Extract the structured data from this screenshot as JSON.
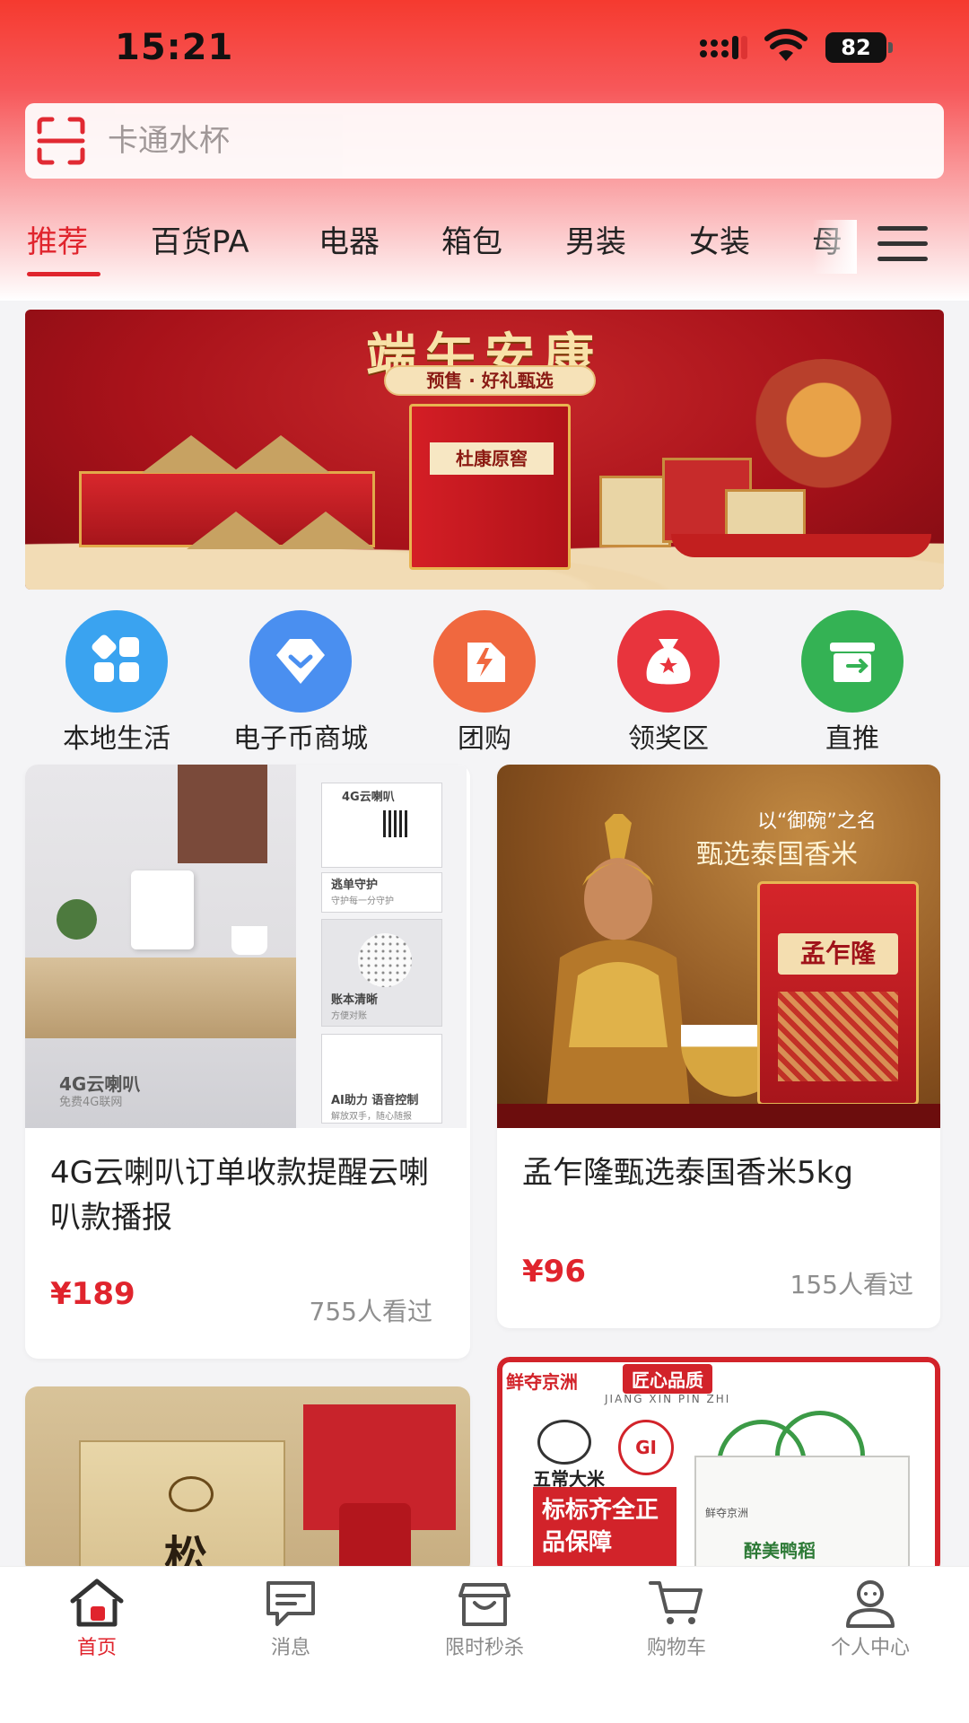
{
  "status_bar": {
    "time": "15:21",
    "battery": "82"
  },
  "search": {
    "placeholder": "卡通水杯"
  },
  "tabs": [
    {
      "label": "推荐",
      "active": true
    },
    {
      "label": "百货PA"
    },
    {
      "label": "电器"
    },
    {
      "label": "箱包"
    },
    {
      "label": "男装"
    },
    {
      "label": "女装"
    },
    {
      "label": "母"
    }
  ],
  "banner": {
    "title": "端午安康",
    "subtitle": "预售 · 好礼甄选",
    "box_label": "杜康原窖"
  },
  "quick_links": [
    {
      "label": "本地生活",
      "color": "#3aa3f0",
      "icon": "grid-icon"
    },
    {
      "label": "电子币商城",
      "color": "#4a8ff0",
      "icon": "diamond-chevron-icon"
    },
    {
      "label": "团购",
      "color": "#f0683f",
      "icon": "tag-lightning-icon"
    },
    {
      "label": "领奖区",
      "color": "#e8343d",
      "icon": "money-bag-icon"
    },
    {
      "label": "直推",
      "color": "#34b254",
      "icon": "share-box-icon"
    }
  ],
  "products": [
    {
      "title": "4G云喇叭订单收款提醒云喇叭款播报",
      "price": "¥189",
      "views": "755人看过",
      "image_text": {
        "caption": "4G云喇叭",
        "caption_sub": "免费4G联网",
        "panel1_title": "4G云喇叭",
        "panel2_title": "逃单守护",
        "panel2_sub": "守护每一分守护",
        "panel3_title": "账本清晰",
        "panel3_sub": "方便对账",
        "panel4_title": "AI助力 语音控制",
        "panel4_sub": "解放双手，随心随报"
      }
    },
    {
      "title": "孟乍隆甄选泰国香米5kg",
      "price": "¥96",
      "views": "155人看过",
      "image_text": {
        "line1": "以“御碗”之名",
        "line2": "甄选泰国香米",
        "brand": "孟乍隆"
      }
    },
    {
      "image_text": {
        "char": "松"
      }
    },
    {
      "image_text": {
        "head": "鲜夺京洲",
        "tag": "匠心品质",
        "sub": "JIANG XIN PIN ZHI",
        "brand": "五常大米",
        "box": "标标齐全正品保障",
        "bag_label": "醉美鸭稻",
        "bag_small": "鲜夺京洲"
      }
    }
  ],
  "bottom_nav": [
    {
      "label": "首页",
      "active": true,
      "icon": "home-icon"
    },
    {
      "label": "消息",
      "icon": "message-icon"
    },
    {
      "label": "限时秒杀",
      "icon": "flash-sale-icon"
    },
    {
      "label": "购物车",
      "icon": "cart-icon"
    },
    {
      "label": "个人中心",
      "icon": "profile-icon"
    }
  ],
  "colors": {
    "accent": "#e0242d",
    "header_top": "#f53a2f"
  }
}
